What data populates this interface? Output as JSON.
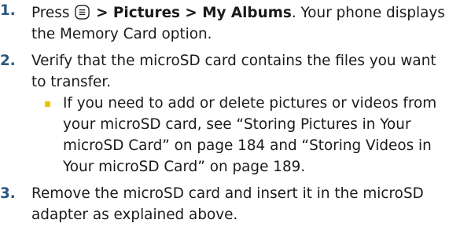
{
  "steps": [
    {
      "number": "1.",
      "text_before": "Press",
      "key_icon": "menu-ok-key-icon",
      "path": "> Pictures > My Albums",
      "text_after": ". Your phone displays the Memory Card option."
    },
    {
      "number": "2.",
      "text": "Verify that the microSD card contains the files you want to transfer.",
      "bullets": [
        {
          "text": "If you need to add or delete pictures or videos from your microSD card, see “Storing Pictures in Your microSD Card” on page 184 and “Storing Videos in Your microSD Card” on page 189."
        }
      ]
    },
    {
      "number": "3.",
      "text": "Remove the microSD card and insert it in the microSD adapter as explained above."
    }
  ],
  "colors": {
    "step_number": "#2a5680",
    "bullet": "#f2c200",
    "text": "#1a1a1a"
  }
}
